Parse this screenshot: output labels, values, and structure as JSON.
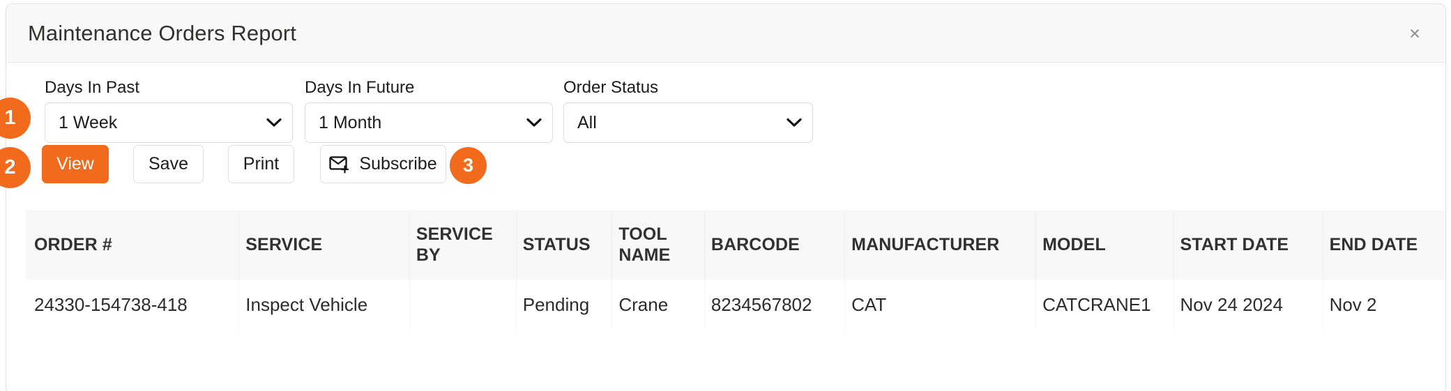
{
  "dialog": {
    "title": "Maintenance Orders Report",
    "close_label": "×",
    "close_icon": "close-icon"
  },
  "filters": {
    "days_in_past": {
      "label": "Days In Past",
      "value": "1 Week",
      "options": [
        "1 Week"
      ]
    },
    "days_in_future": {
      "label": "Days In Future",
      "value": "1 Month",
      "options": [
        "1 Month"
      ]
    },
    "order_status": {
      "label": "Order Status",
      "value": "All",
      "options": [
        "All"
      ]
    }
  },
  "actions": {
    "view_label": "View",
    "save_label": "Save",
    "print_label": "Print",
    "subscribe_label": "Subscribe",
    "subscribe_icon": "envelope-plus-icon"
  },
  "badges": {
    "one": "1",
    "two": "2",
    "three": "3"
  },
  "colors": {
    "accent": "#f26a1b",
    "header_bg": "#f8f8f8",
    "table_header_bg": "#f8f8f7",
    "text": "#33312e",
    "border": "#e3e3e3"
  },
  "table": {
    "columns": [
      "ORDER #",
      "SERVICE",
      "SERVICE BY",
      "STATUS",
      "TOOL NAME",
      "BARCODE",
      "MANUFACTURER",
      "MODEL",
      "START DATE",
      "END DATE"
    ],
    "rows": [
      {
        "order": "24330-154738-418",
        "service": "Inspect Vehicle",
        "service_by": "",
        "status": "Pending",
        "tool_name": "Crane",
        "barcode": "8234567802",
        "manufacturer": "CAT",
        "model": "CATCRANE1",
        "start_date": "Nov 24 2024",
        "end_date": "Nov 2"
      }
    ]
  }
}
